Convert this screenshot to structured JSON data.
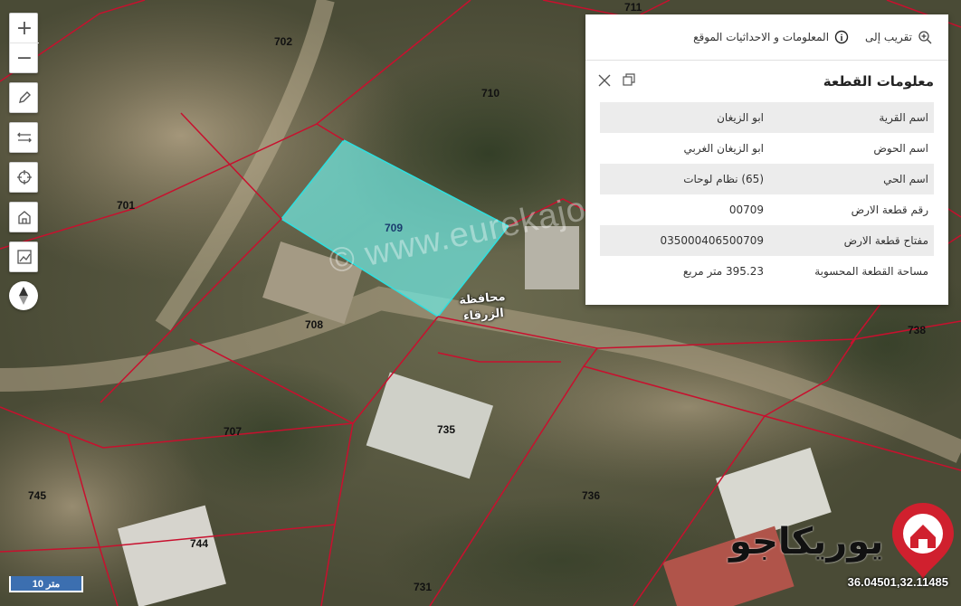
{
  "map": {
    "parcels": [
      {
        "id": "p711",
        "label": "711"
      },
      {
        "id": "p702",
        "label": "702"
      },
      {
        "id": "p710",
        "label": "710"
      },
      {
        "id": "p701",
        "label": "701"
      },
      {
        "id": "p709",
        "label": "709"
      },
      {
        "id": "p708",
        "label": "708"
      },
      {
        "id": "p707",
        "label": "707"
      },
      {
        "id": "p735",
        "label": "735"
      },
      {
        "id": "p736",
        "label": "736"
      },
      {
        "id": "p738",
        "label": "738"
      },
      {
        "id": "p745",
        "label": "745"
      },
      {
        "id": "p744",
        "label": "744"
      },
      {
        "id": "p731",
        "label": "731"
      }
    ],
    "governorate_label_line1": "محافظة",
    "governorate_label_line2": "الزرقاء",
    "watermark": "© www.eurekajo.com",
    "highlight_color": "#6fe8e0",
    "boundary_color": "#c8102e"
  },
  "toolbar": {
    "zoom_in": "+",
    "zoom_out": "−",
    "draw_icon": "pencil-icon",
    "measure_icon": "measure-icon",
    "locate_icon": "crosshair-icon",
    "home_icon": "home-icon",
    "print_icon": "chart-icon",
    "compass_icon": "compass-icon"
  },
  "panel": {
    "tab_zoom": "تقريب إلى",
    "tab_info": "المعلومات و الاحداثيات الموقع",
    "title": "معلومات القطعة",
    "rows": [
      {
        "key": "اسم القرية",
        "value": "ابو الزيغان"
      },
      {
        "key": "اسم الحوض",
        "value": "ابو الزيغان الغربي"
      },
      {
        "key": "اسم الحي",
        "value": "(65) نظام لوحات"
      },
      {
        "key": "رقم قطعة الارض",
        "value": "00709"
      },
      {
        "key": "مفتاح قطعة الارض",
        "value": "035000406500709"
      },
      {
        "key": "مساحة القطعة المحسوبة",
        "value": "395.23 متر مربع"
      }
    ]
  },
  "scale_label": "10 متر",
  "coordinates": "36.04501,32.11485",
  "brand_text": "يوريكاجو"
}
